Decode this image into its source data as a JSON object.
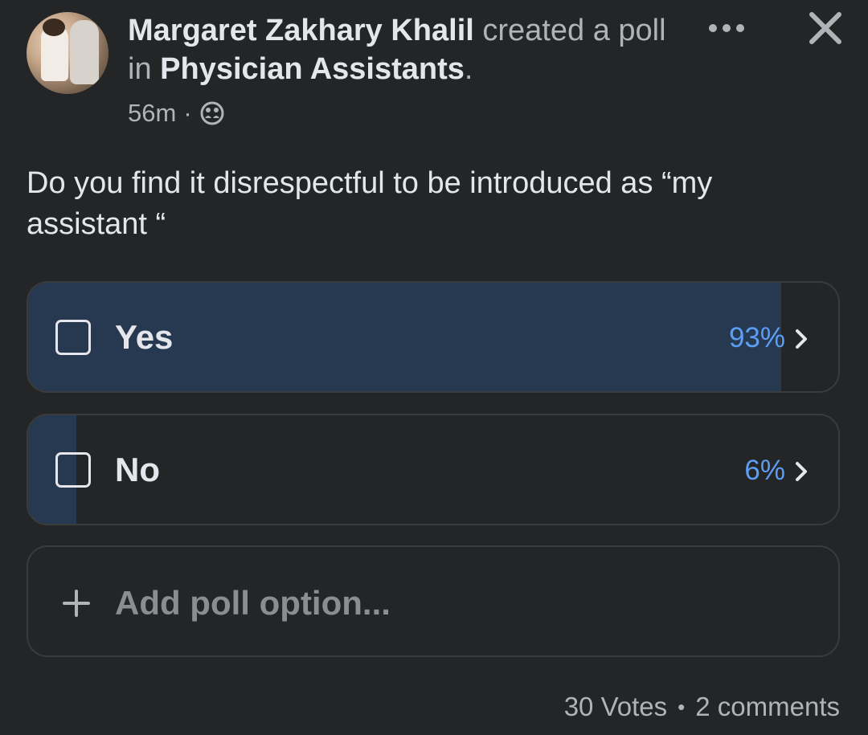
{
  "post": {
    "author": "Margaret Zakhary Khalil",
    "action_pre": "created a",
    "action_mid": "poll in",
    "group": "Physician Assistants",
    "action_end": ".",
    "time": "56m",
    "meta_dot": "·",
    "privacy_icon": "group-members-icon",
    "more_icon": "more-dots-icon",
    "close_icon": "close-icon"
  },
  "poll": {
    "question": "Do you find it disrespectful to be introduced as “my assistant “",
    "options": [
      {
        "label": "Yes",
        "percent_text": "93%",
        "fill_percent": 93
      },
      {
        "label": "No",
        "percent_text": "6%",
        "fill_percent": 6
      }
    ],
    "add_option_label": "Add poll option..."
  },
  "footer": {
    "votes": "30 Votes",
    "separator": "•",
    "comments": "2 comments"
  },
  "colors": {
    "background": "#242526",
    "bar_fill": "#263951",
    "percent_text": "#5d9ef5"
  }
}
